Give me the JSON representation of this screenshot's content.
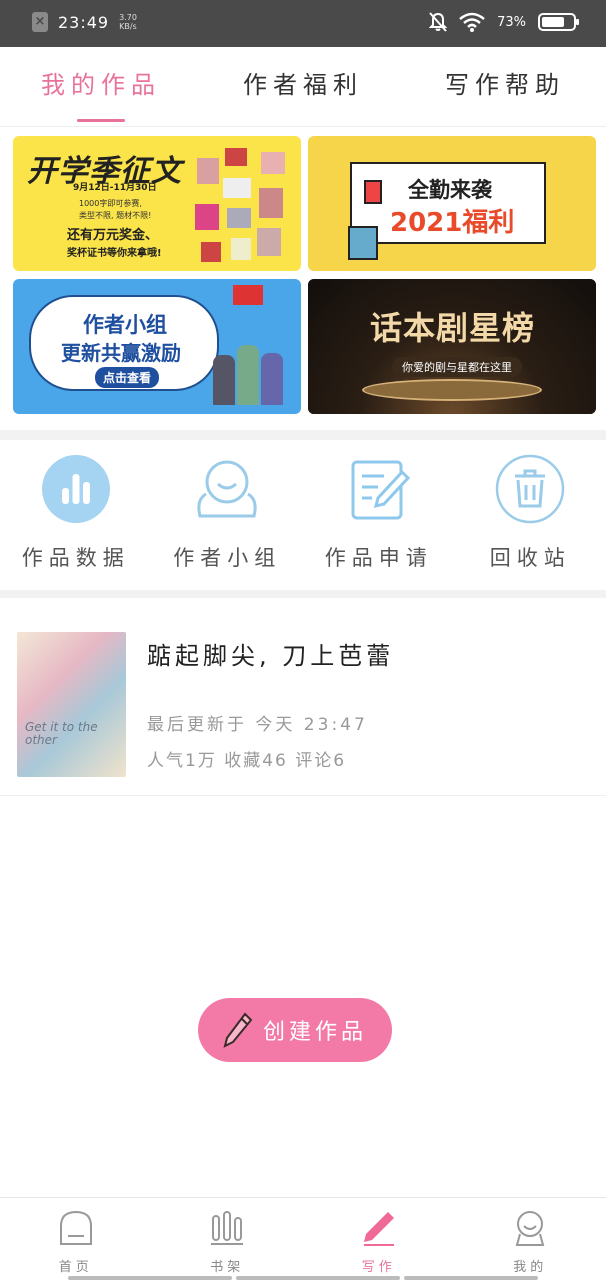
{
  "status": {
    "time": "23:49",
    "speed_top": "3.70",
    "speed_bottom": "KB/s",
    "battery": "73%"
  },
  "tabs": [
    {
      "label": "我的作品",
      "active": true
    },
    {
      "label": "作者福利",
      "active": false
    },
    {
      "label": "写作帮助",
      "active": false
    }
  ],
  "banners": {
    "b1_title": "开学季征文",
    "b1_date": "9月12日-11月30日",
    "b1_line1": "1000字即可参赛,",
    "b1_line2": "类型不限, 题材不限!",
    "b1_line3": "还有万元奖金、",
    "b1_line4": "奖杯证书等你来拿哦!",
    "b2_line1": "全勤来袭",
    "b2_line2": "2021福利",
    "b3_line1": "作者小组",
    "b3_line2": "更新共赢激励",
    "b3_button": "点击查看",
    "b4_title": "话本剧星榜",
    "b4_sub": "你爱的剧与星都在这里"
  },
  "quick": [
    {
      "label": "作品数据",
      "icon": "bar-chart-icon"
    },
    {
      "label": "作者小组",
      "icon": "group-icon"
    },
    {
      "label": "作品申请",
      "icon": "edit-document-icon"
    },
    {
      "label": "回收站",
      "icon": "trash-icon"
    }
  ],
  "work": {
    "cover_text": "Get it to the other",
    "title": "踮起脚尖, 刀上芭蕾",
    "updated": "最后更新于 今天 23:47",
    "stats": "人气1万 收藏46 评论6"
  },
  "create": {
    "label": "创建作品"
  },
  "nav": [
    {
      "label": "首页",
      "active": false
    },
    {
      "label": "书架",
      "active": false
    },
    {
      "label": "写作",
      "active": true
    },
    {
      "label": "我的",
      "active": false
    }
  ],
  "colors": {
    "accent": "#e8739a",
    "icon_blue": "#8ec8ec",
    "create_bg": "#f37aa6"
  }
}
